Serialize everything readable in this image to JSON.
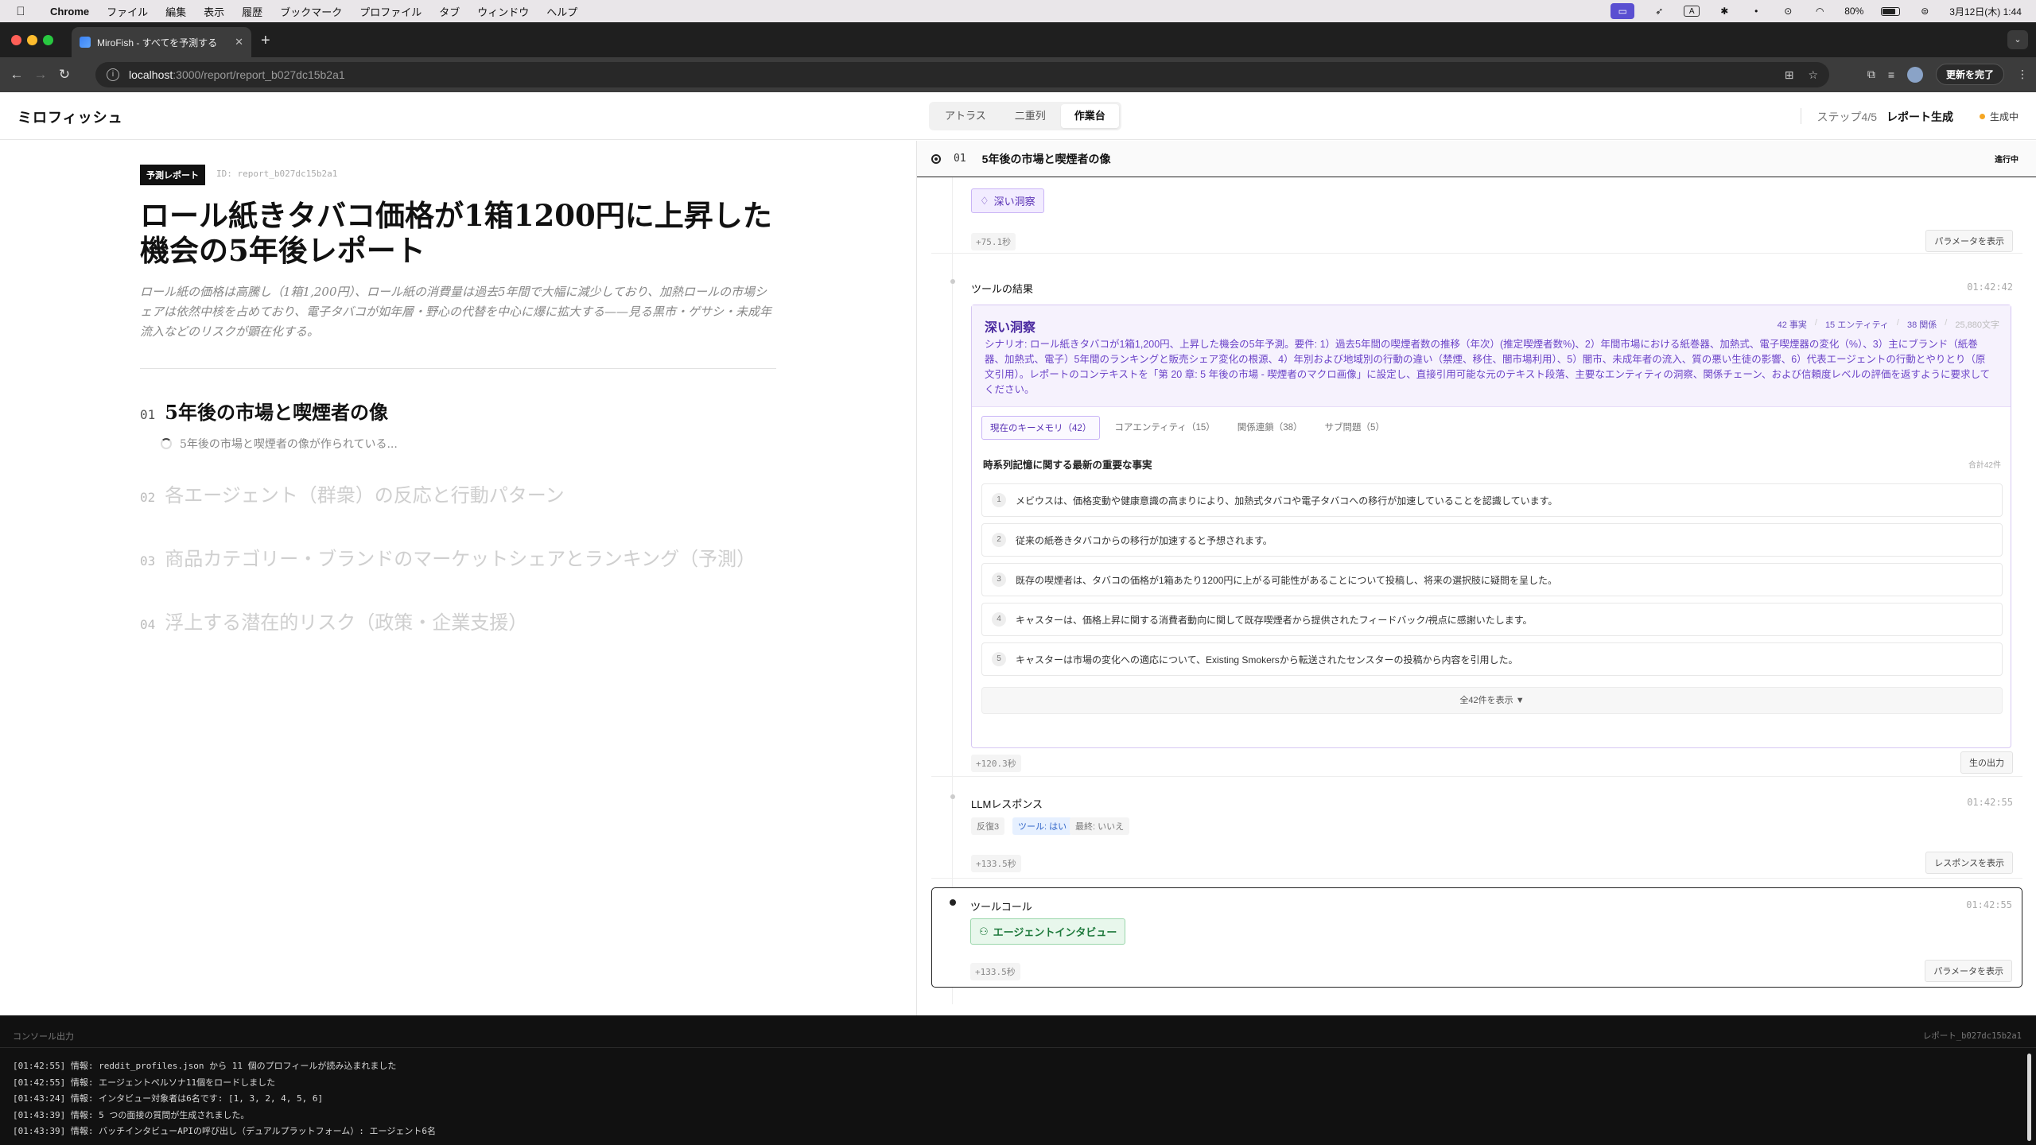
{
  "menubar": {
    "app": "Chrome",
    "menus": [
      "ファイル",
      "編集",
      "表示",
      "履歴",
      "ブックマーク",
      "プロファイル",
      "タブ",
      "ウィンドウ",
      "ヘルプ"
    ],
    "battery": "80%",
    "datetime": "3月12日(木) 1:44"
  },
  "browser": {
    "tab_title": "MiroFish - すべてを予測する",
    "url_host": "localhost",
    "url_path": ":3000/report/report_b027dc15b2a1",
    "update_label": "更新を完了"
  },
  "header": {
    "brand": "ミロフィッシュ",
    "view_tabs": [
      "アトラス",
      "二重列",
      "作業台"
    ],
    "active_view": "作業台",
    "step": "ステップ4/5",
    "step_name": "レポート生成",
    "status": "生成中"
  },
  "report": {
    "tag": "予測レポート",
    "id": "ID: report_b027dc15b2a1",
    "title": "ロール紙きタバコ価格が1箱1200円に上昇した機会の5年後レポート",
    "summary": "ロール紙の価格は高騰し（1箱1,200円）、ロール紙の消費量は過去5年間で大幅に減少しており、加熱ロールの市場シェアは依然中核を占めており、電子タバコが如年層・野心の代替を中心に爆に拡大する——見る黒市・ゲサシ・未成年流入などのリスクが顕在化する。",
    "sections": [
      {
        "num": "01",
        "title": "5年後の市場と喫煙者の像",
        "progress": "5年後の市場と喫煙者の像が作られている..."
      },
      {
        "num": "02",
        "title": "各エージェント（群衆）の反応と行動パターン"
      },
      {
        "num": "03",
        "title": "商品カテゴリー・ブランドのマーケットシェアとランキング（予測）"
      },
      {
        "num": "04",
        "title": "浮上する潜在的リスク（政策・企業支援）"
      }
    ]
  },
  "workbench": {
    "section_num": "01",
    "section_title": "5年後の市場と喫煙者の像",
    "section_state": "進行中",
    "card1": {
      "tool": "深い洞察",
      "elapsed": "+75.1秒",
      "button": "パラメータを表示"
    },
    "card2": {
      "title": "ツールの結果",
      "time": "01:42:42",
      "insight_title": "深い洞察",
      "stats": {
        "facts": "42 事実",
        "entities": "15 エンティティ",
        "relations": "38 関係",
        "chars": "25,880文字"
      },
      "scenario": "シナリオ: ロール紙きタバコが1箱1,200円、上昇した機会の5年予測。要件: 1）過去5年間の喫煙者数の推移（年次）(推定喫煙者数%)、2）年間市場における紙巻器、加熱式、電子喫煙器の変化（%）、3）主にブランド（紙巻器、加熱式、電子）5年間のランキングと販売シェア変化の根源、4）年別および地域別の行動の違い（禁煙、移住、闇市場利用）、5）闇市、未成年者の流入、質の悪い生徒の影響、6）代表エージェントの行動とやりとり（原文引用）。レポートのコンテキストを「第 20 章: 5 年後の市場 - 喫煙者のマクロ画像」に設定し、直接引用可能な元のテキスト段落、主要なエンティティの洞察、関係チェーン、および信頼度レベルの評価を返すように要求してください。",
      "tabs": [
        "現在のキーメモリ（42）",
        "コアエンティティ（15）",
        "関係連鎖（38）",
        "サブ問題（5）"
      ],
      "facts_title": "時系列記憶に関する最新の重要な事実",
      "facts_total": "合計42件",
      "facts": [
        "メビウスは、価格変動や健康意識の高まりにより、加熱式タバコや電子タバコへの移行が加速していることを認識しています。",
        "従来の紙巻きタバコからの移行が加速すると予想されます。",
        "既存の喫煙者は、タバコの価格が1箱あたり1200円に上がる可能性があることについて投稿し、将来の選択肢に疑問を呈した。",
        "キャスターは、価格上昇に関する消費者動向に関して既存喫煙者から提供されたフィードバック/視点に感謝いたします。",
        "キャスターは市場の変化への適応について、Existing Smokersから転送されたセンスターの投稿から内容を引用した。"
      ],
      "show_all": "全42件を表示 ▼",
      "elapsed": "+120.3秒",
      "button": "生の出力"
    },
    "card3": {
      "title": "LLMレスポンス",
      "time": "01:42:55",
      "chips": [
        "反復3",
        "ツール: はい",
        "最終: いいえ"
      ],
      "elapsed": "+133.5秒",
      "button": "レスポンスを表示"
    },
    "card4": {
      "title": "ツールコール",
      "time": "01:42:55",
      "tool": "エージェントインタビュー",
      "elapsed": "+133.5秒",
      "button": "パラメータを表示"
    }
  },
  "console": {
    "label": "コンソール出力",
    "id": "レポート_b027dc15b2a1",
    "lines": [
      "[01:42:55] 情報: reddit_profiles.json から 11 個のプロフィールが読み込まれました",
      "[01:42:55] 情報: エージェントペルソナ11個をロードしました",
      "[01:43:24] 情報: インタビュー対象者は6名です: [1, 3, 2, 4, 5, 6]",
      "[01:43:39] 情報: 5 つの面接の質問が生成されました。",
      "[01:43:39] 情報: バッチインタビューAPIの呼び出し（デュアルプラットフォーム）: エージェント6名"
    ]
  },
  "colors": {
    "accent_purple": "#5b33b6",
    "accent_green": "#1f7a3d",
    "status_orange": "#f5a623"
  }
}
